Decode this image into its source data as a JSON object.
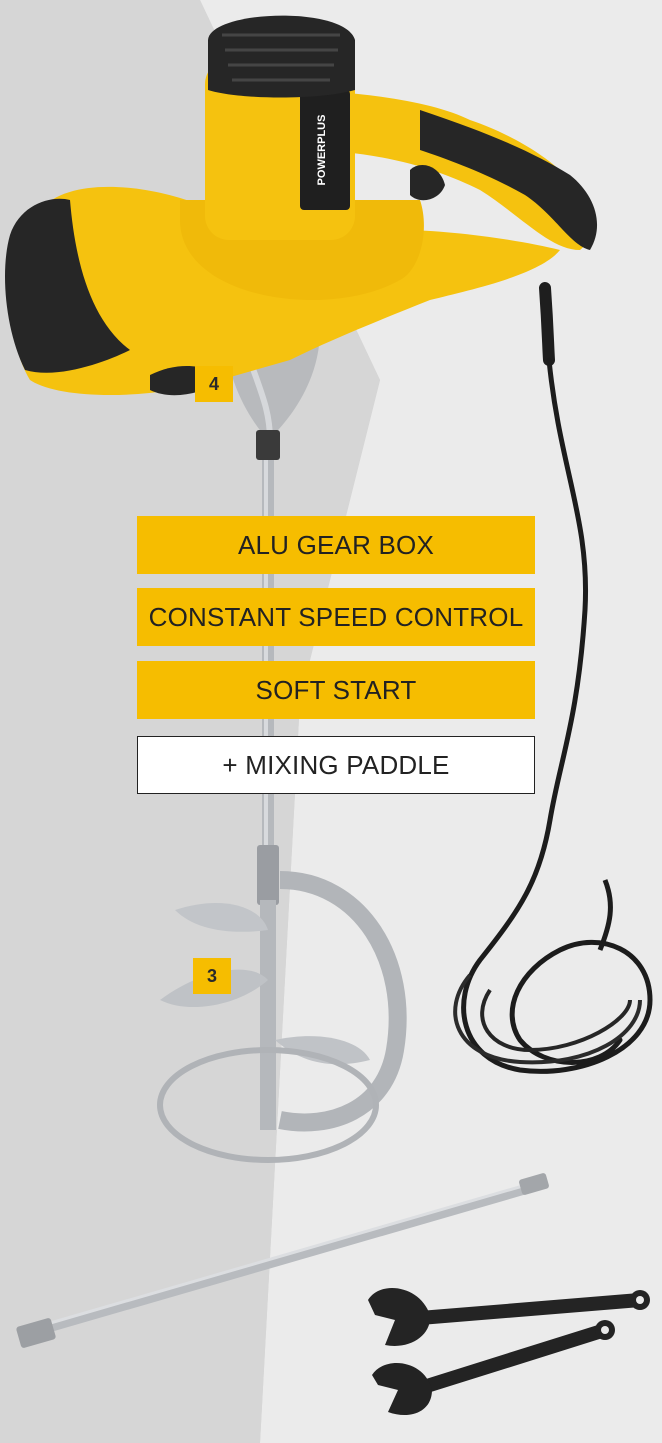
{
  "features": [
    {
      "label": "ALU GEAR BOX",
      "style": "yellow"
    },
    {
      "label": "CONSTANT SPEED CONTROL",
      "style": "yellow"
    },
    {
      "label": "SOFT START",
      "style": "yellow"
    },
    {
      "label": "+ MIXING PADDLE",
      "style": "outline"
    }
  ],
  "callouts": {
    "gearbox": "4",
    "paddle": "3"
  },
  "product_label": "POWERPLUS",
  "colors": {
    "accent": "#f6bd00",
    "tool_body": "#f5c20f",
    "grip": "#262626",
    "background_light": "#ececec",
    "background_dark": "#d3d3d3",
    "metal": "#b9bcc0",
    "text": "#222222"
  }
}
